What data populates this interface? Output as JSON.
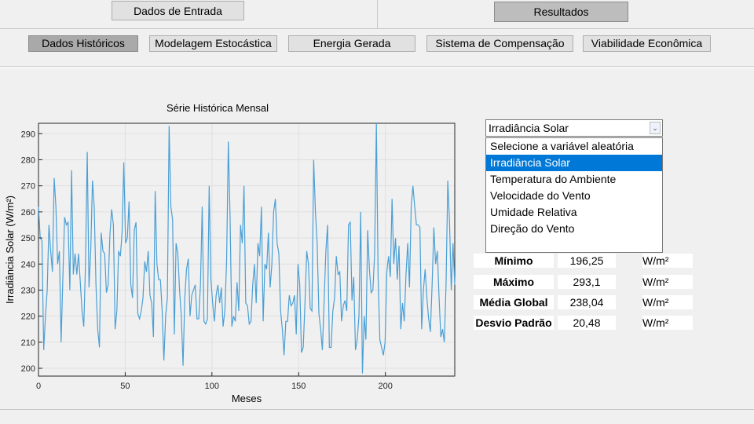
{
  "top_buttons": {
    "input_data": "Dados de Entrada",
    "results": "Resultados"
  },
  "tabs": [
    {
      "label": "Dados Históricos",
      "active": true
    },
    {
      "label": "Modelagem Estocástica",
      "active": false
    },
    {
      "label": "Energia Gerada",
      "active": false
    },
    {
      "label": "Sistema de Compensação",
      "active": false
    },
    {
      "label": "Viabilidade Econômica",
      "active": false
    }
  ],
  "variable_select": {
    "selected": "Irradiância Solar",
    "options": [
      "Selecione a variável aleatória",
      "Irradiância Solar",
      "Temperatura do Ambiente",
      "Velocidade do Vento",
      "Umidade Relativa",
      "Direção do Vento"
    ],
    "highlighted_index": 1
  },
  "stats": [
    {
      "label": "Mínimo",
      "value": "196,25",
      "unit": "W/m²"
    },
    {
      "label": "Máximo",
      "value": "293,1",
      "unit": "W/m²"
    },
    {
      "label": "Média Global",
      "value": "238,04",
      "unit": "W/m²"
    },
    {
      "label": "Desvio Padrão",
      "value": "20,48",
      "unit": "W/m²"
    }
  ],
  "colors": {
    "line": "#4a9fd5",
    "selected_option": "#0078d7",
    "active_tab": "#a9a9a9"
  },
  "chart_data": {
    "type": "line",
    "title": "Série Histórica Mensal",
    "xlabel": "Meses",
    "ylabel": "Irradiância Solar (W/m²)",
    "xlim": [
      0,
      240
    ],
    "ylim": [
      197,
      294
    ],
    "xticks": [
      0,
      50,
      100,
      150,
      200
    ],
    "yticks": [
      200,
      210,
      220,
      230,
      240,
      250,
      260,
      270,
      280,
      290
    ],
    "grid": true,
    "series": [
      {
        "values": [
          262,
          250,
          249,
          207,
          220,
          230,
          255,
          245,
          237,
          273,
          262,
          240,
          245,
          210,
          235,
          258,
          255,
          256,
          230,
          276,
          236,
          244,
          236,
          244,
          233,
          222,
          216,
          240,
          283,
          231,
          245,
          272,
          262,
          232,
          215,
          208,
          252,
          245,
          244,
          229,
          232,
          251,
          261,
          255,
          215,
          222,
          245,
          243,
          252,
          279,
          248,
          250,
          264,
          232,
          227,
          253,
          256,
          221,
          219,
          222,
          227,
          241,
          237,
          245,
          228,
          225,
          212,
          268,
          240,
          234,
          234,
          222,
          203,
          220,
          227,
          293,
          262,
          257,
          213,
          248,
          244,
          230,
          220,
          201,
          227,
          238,
          242,
          220,
          228,
          230,
          232,
          219,
          219,
          232,
          262,
          218,
          217,
          219,
          270,
          234,
          225,
          218,
          228,
          232,
          225,
          231,
          216,
          222,
          241,
          287,
          258,
          216,
          220,
          218,
          233,
          222,
          255,
          248,
          270,
          225,
          224,
          217,
          218,
          232,
          240,
          225,
          248,
          243,
          262,
          218,
          240,
          238,
          252,
          231,
          240,
          260,
          265,
          248,
          244,
          222,
          215,
          205,
          218,
          218,
          228,
          224,
          225,
          228,
          213,
          240,
          232,
          206,
          208,
          225,
          245,
          240,
          223,
          222,
          280,
          260,
          248,
          221,
          215,
          207,
          226,
          245,
          255,
          208,
          208,
          222,
          227,
          243,
          236,
          237,
          218,
          224,
          226,
          222,
          255,
          256,
          226,
          235,
          207,
          211,
          220,
          260,
          198,
          220,
          211,
          253,
          238,
          229,
          230,
          244,
          296,
          235,
          211,
          208,
          205,
          210,
          237,
          243,
          235,
          265,
          240,
          250,
          234,
          247,
          215,
          225,
          218,
          236,
          248,
          231,
          262,
          270,
          262,
          255,
          255,
          254,
          215,
          230,
          238,
          227,
          219,
          214,
          232,
          254,
          240,
          245,
          227,
          212,
          215,
          210,
          232,
          272,
          256,
          230,
          248,
          232
        ]
      }
    ]
  }
}
